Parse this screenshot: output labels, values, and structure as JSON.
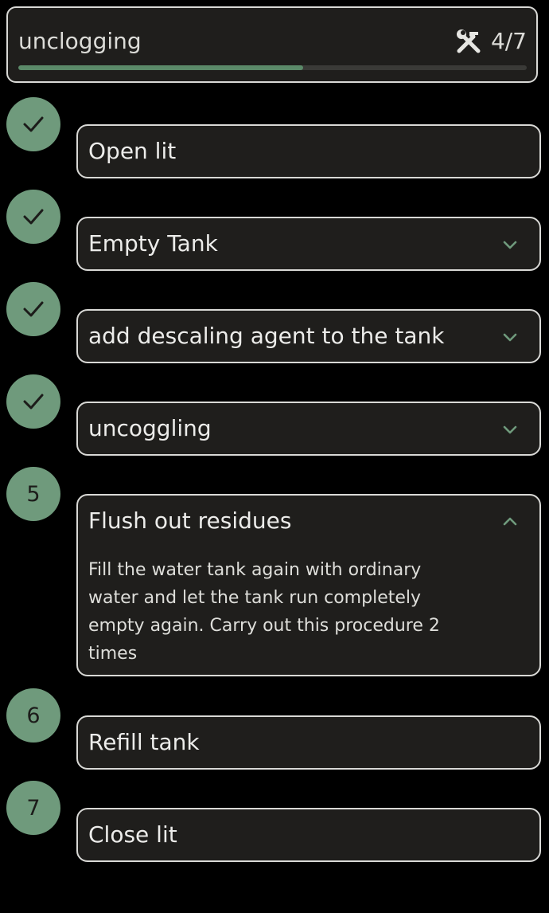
{
  "header": {
    "title": "unclogging",
    "progress_text": "4/7",
    "progress_fraction": 0.56,
    "tools_icon": "hammer-wrench-icon"
  },
  "colors": {
    "background": "#000000",
    "card": "#1f1e1c",
    "accent": "#6f9a7c",
    "progress_fill": "#5b8a69",
    "border": "#d9d9d6"
  },
  "steps": [
    {
      "marker": "✓",
      "completed": true,
      "label": "Open lit",
      "chevron": "none"
    },
    {
      "marker": "✓",
      "completed": true,
      "label": "Empty Tank",
      "chevron": "down"
    },
    {
      "marker": "✓",
      "completed": true,
      "label": "add descaling agent to the tank",
      "chevron": "down"
    },
    {
      "marker": "✓",
      "completed": true,
      "label": "uncoggling",
      "chevron": "down"
    },
    {
      "marker": "5",
      "completed": false,
      "label": "Flush out residues",
      "chevron": "up",
      "description": "Fill the water tank again with ordinary water and let the tank run completely empty again. Carry out this procedure 2 times"
    },
    {
      "marker": "6",
      "completed": false,
      "label": "Refill tank",
      "chevron": "none"
    },
    {
      "marker": "7",
      "completed": false,
      "label": "Close lit",
      "chevron": "none"
    }
  ]
}
